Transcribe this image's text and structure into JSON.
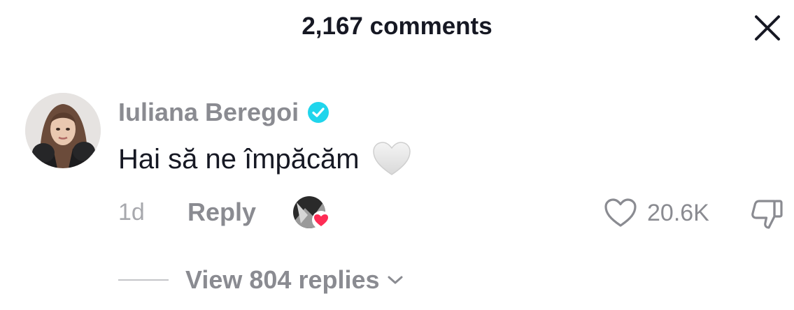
{
  "header": {
    "title": "2,167 comments",
    "close_icon": "close-icon"
  },
  "comment": {
    "avatar_icon": "user-avatar",
    "username": "Iuliana Beregoi",
    "verified_icon": "verified-badge-icon",
    "text": "Hai să ne împăcăm",
    "emoji_icon": "white-heart-icon",
    "timestamp": "1d",
    "reply_label": "Reply",
    "creator_liked_icon": "creator-liked-heart-icon",
    "like_icon": "heart-outline-icon",
    "like_count": "20.6K",
    "dislike_icon": "thumbs-down-icon",
    "view_replies_label": "View 804 replies",
    "view_replies_icon": "chevron-down-icon"
  },
  "colors": {
    "text_primary": "#161823",
    "text_secondary": "#8a8b91",
    "verified_blue": "#20d5ec",
    "like_red": "#fe2c55"
  }
}
